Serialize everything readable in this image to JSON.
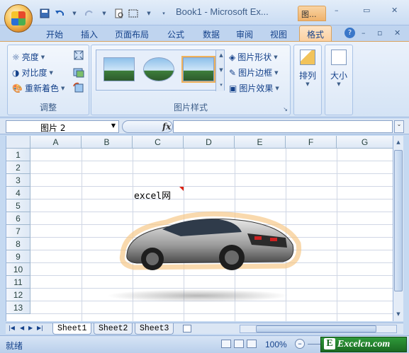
{
  "window": {
    "title": "Book1 - Microsoft Ex...",
    "context_tab_title": "图...",
    "controls": [
      "–",
      "▭",
      "✕"
    ]
  },
  "ribbon_tabs": [
    {
      "label": "开始"
    },
    {
      "label": "插入"
    },
    {
      "label": "页面布局"
    },
    {
      "label": "公式"
    },
    {
      "label": "数据"
    },
    {
      "label": "审阅"
    },
    {
      "label": "视图"
    },
    {
      "label": "格式",
      "active": true
    }
  ],
  "adjust_group": {
    "label": "调整",
    "brightness": "亮度",
    "contrast": "对比度",
    "recolor": "重新着色"
  },
  "styles_group": {
    "label": "图片样式",
    "shape": "图片形状",
    "border": "图片边框",
    "effects": "图片效果"
  },
  "arrange_group": {
    "label": "排列"
  },
  "size_group": {
    "label": "大小"
  },
  "formula_bar": {
    "name_box": "图片 2",
    "fx": "fx",
    "formula": ""
  },
  "columns": [
    "A",
    "B",
    "C",
    "D",
    "E",
    "F",
    "G"
  ],
  "rows": [
    "1",
    "2",
    "3",
    "4",
    "5",
    "6",
    "7",
    "8",
    "9",
    "10",
    "11",
    "12",
    "13"
  ],
  "cell_D4_text": "excel网",
  "sheets": [
    {
      "name": "Sheet1",
      "active": true
    },
    {
      "name": "Sheet2",
      "active": false
    },
    {
      "name": "Sheet3",
      "active": false
    }
  ],
  "status": {
    "ready": "就绪",
    "zoom": "100%"
  },
  "watermark": {
    "badge": "E",
    "text": "Excelcn.com"
  },
  "colors": {
    "accent_orange": "#fbd0a0",
    "ribbon_blue": "#15428b",
    "watermark_green": "#2f9a3a"
  }
}
